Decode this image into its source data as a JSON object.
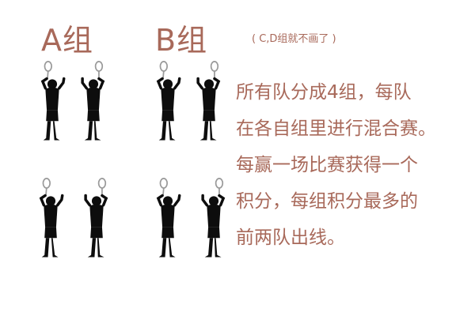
{
  "groups": {
    "a_label": "A组",
    "b_label": "B组",
    "note": "( C,D组就不画了 )"
  },
  "description": {
    "lines": [
      "所有队分成4组，每队",
      "在各自组里进行混合赛。",
      "每赢一场比赛获得一个",
      "积分，每组积分最多的",
      "前两队出线。"
    ]
  },
  "figure": {
    "players": 8,
    "player_color": "#0d0d0d",
    "racket_color": "#9a9a9a",
    "icon": "badminton-player-icon"
  },
  "colors": {
    "text": "#a8695a",
    "background": "#ffffff"
  }
}
